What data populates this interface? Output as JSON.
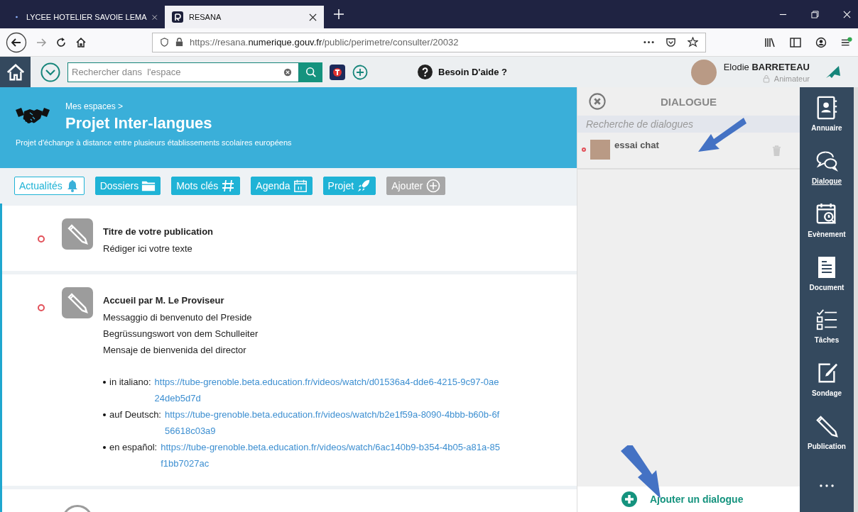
{
  "browser": {
    "tabs": [
      {
        "title": "LYCEE HOTELIER SAVOIE LEMA",
        "selected": false
      },
      {
        "title": "RESANA",
        "selected": true
      }
    ],
    "url": {
      "start": "https://resana.",
      "domain": "numerique.gouv.fr",
      "path": "/public/perimetre/consulter/20032"
    }
  },
  "header": {
    "search": {
      "placeholder": "Rechercher dans  l'espace"
    },
    "help": "Besoin D'aide ?",
    "user": {
      "name": "Elodie **BARRETEAU**",
      "role": "Animateur"
    }
  },
  "banner": {
    "breadcrumb": "Mes espaces >",
    "title": "Projet Inter-langues",
    "description": "Projet d'échange à distance entre plusieurs établissements scolaires européens"
  },
  "nav": [
    {
      "label": "Actualités",
      "kind": "section",
      "selected": true
    },
    {
      "label": "Dossiers",
      "kind": "section",
      "selected": false
    },
    {
      "label": "Mots clés",
      "kind": "section",
      "selected": false
    },
    {
      "label": "Agenda",
      "kind": "section",
      "selected": false
    },
    {
      "label": "Projet",
      "kind": "section",
      "selected": false
    },
    {
      "label": "Ajouter",
      "kind": "add",
      "selected": false
    }
  ],
  "posts": [
    {
      "unread": true,
      "title": "Titre de votre publication",
      "lines": [
        "Rédiger ici votre texte"
      ]
    },
    {
      "unread": true,
      "title": "Accueil par M. Le Proviseur",
      "lines": [
        "Messaggio di benvenuto del Preside",
        "Begrüssungswort von dem Schulleiter",
        "Mensaje de bienvenida del director"
      ],
      "links": [
        {
          "label": "in italiano:",
          "url": "https://tube-grenoble.beta.education.fr/videos/watch/d01536a4-dde6-4215-9c97-0ae24deb5d7d"
        },
        {
          "label": "auf Deutsch:",
          "url": "https://tube-grenoble.beta.education.fr/videos/watch/b2e1f59a-8090-4bbb-b60b-6f56618c03a9"
        },
        {
          "label": "en español:",
          "url": "https://tube-grenoble.beta.education.fr/videos/watch/6ac140b9-b354-4b05-a81a-85f1bb7027ac"
        }
      ]
    }
  ],
  "dialogue": {
    "title": "DIALOGUE",
    "search": {
      "placeholder": "Recherche de dialogues"
    },
    "conversations": [
      {
        "name": "essai chat",
        "unread": true
      }
    ],
    "add_button": "Ajouter un dialogue"
  },
  "sidebar": [
    {
      "label": "Annuaire",
      "selected": false
    },
    {
      "label": "Dialogue",
      "selected": true
    },
    {
      "label": "Evènement",
      "selected": false
    },
    {
      "label": "Document",
      "selected": false
    },
    {
      "label": "Tâches",
      "selected": false
    },
    {
      "label": "Sondage",
      "selected": false
    },
    {
      "label": "Publication",
      "selected": false
    }
  ]
}
